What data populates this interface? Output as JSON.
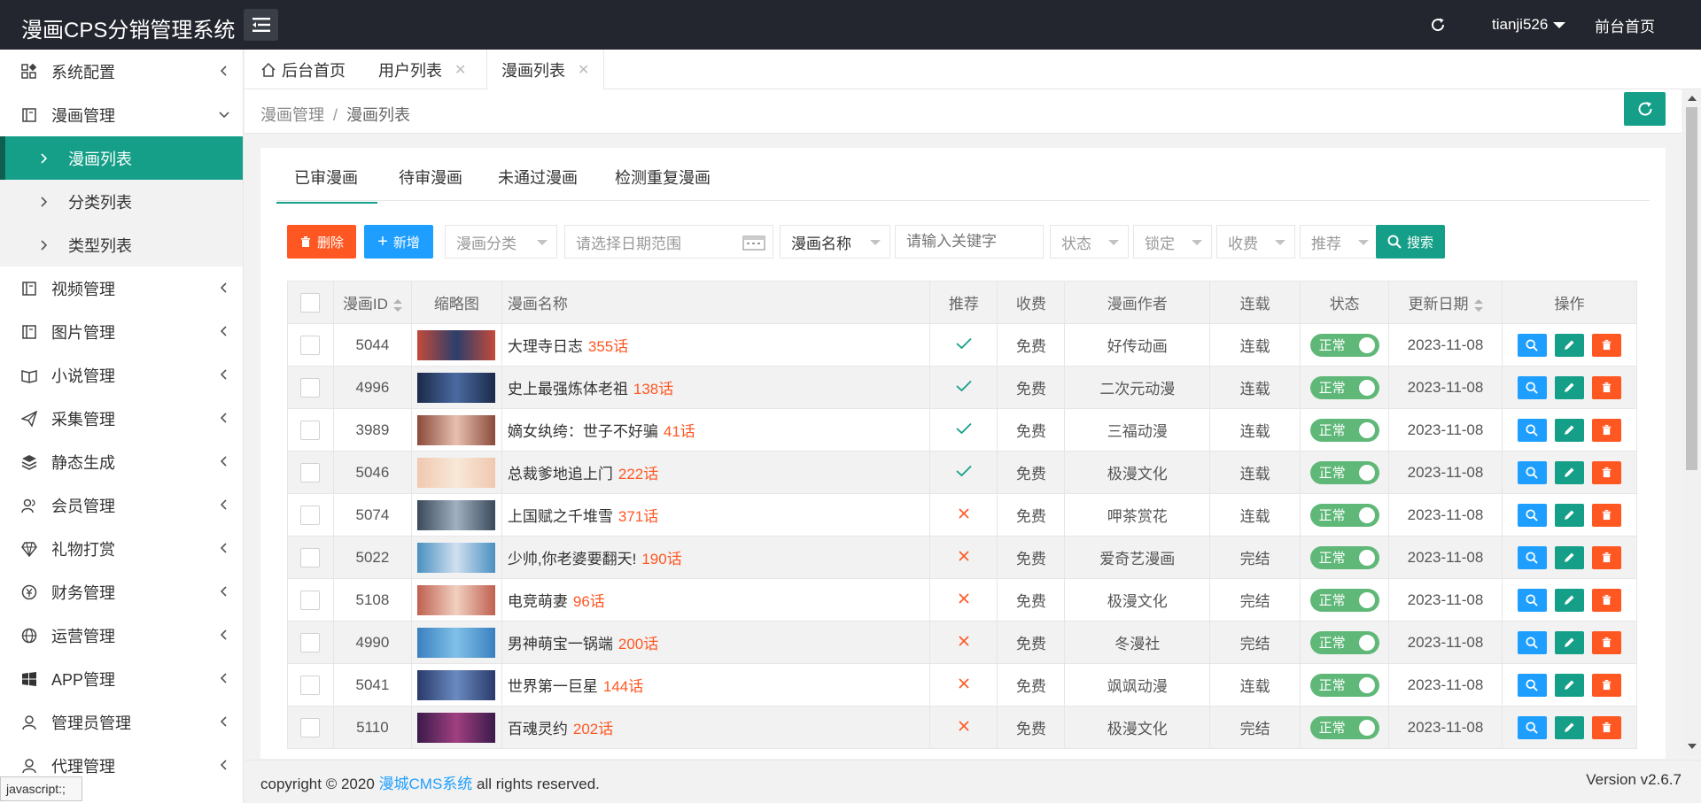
{
  "header": {
    "logo": "漫画CPS分销管理系统",
    "username": "tianji526",
    "front_link": "前台首页"
  },
  "sidebar": {
    "items": [
      {
        "label": "系统配置",
        "icon": "config-grid-icon"
      },
      {
        "label": "漫画管理",
        "icon": "comic-book-icon",
        "expanded": true
      },
      {
        "label": "视频管理",
        "icon": "video-icon"
      },
      {
        "label": "图片管理",
        "icon": "image-icon"
      },
      {
        "label": "小说管理",
        "icon": "novel-book-icon"
      },
      {
        "label": "采集管理",
        "icon": "collect-plane-icon"
      },
      {
        "label": "静态生成",
        "icon": "layers-icon"
      },
      {
        "label": "会员管理",
        "icon": "members-icon"
      },
      {
        "label": "礼物打赏",
        "icon": "diamond-icon"
      },
      {
        "label": "财务管理",
        "icon": "finance-yen-icon"
      },
      {
        "label": "运营管理",
        "icon": "globe-icon"
      },
      {
        "label": "APP管理",
        "icon": "windows-icon"
      },
      {
        "label": "管理员管理",
        "icon": "admin-user-icon"
      },
      {
        "label": "代理管理",
        "icon": "agent-icon"
      }
    ],
    "subitems": [
      {
        "label": "漫画列表",
        "active": true
      },
      {
        "label": "分类列表"
      },
      {
        "label": "类型列表"
      }
    ]
  },
  "tabs": [
    {
      "label": "后台首页"
    },
    {
      "label": "用户列表"
    },
    {
      "label": "漫画列表",
      "active": true
    }
  ],
  "breadcrumb": {
    "parent": "漫画管理",
    "sep": "/",
    "current": "漫画列表"
  },
  "subtabs": [
    "已审漫画",
    "待审漫画",
    "未通过漫画",
    "检测重复漫画"
  ],
  "toolbar": {
    "delete_label": "删除",
    "add_label": "新增",
    "category_placeholder": "漫画分类",
    "date_placeholder": "请选择日期范围",
    "field_select": "漫画名称",
    "keyword_placeholder": "请输入关键字",
    "status_placeholder": "状态",
    "lock_placeholder": "锁定",
    "fee_placeholder": "收费",
    "recommend_placeholder": "推荐",
    "search_label": "搜索"
  },
  "table": {
    "columns": [
      "漫画ID",
      "缩略图",
      "漫画名称",
      "推荐",
      "收费",
      "漫画作者",
      "连载",
      "状态",
      "更新日期",
      "操作"
    ],
    "rows": [
      {
        "id": "5044",
        "name": "大理寺日志",
        "chapters": "355话",
        "recommend": true,
        "fee": "免费",
        "author": "好传动画",
        "serial": "连载",
        "status": "正常",
        "date": "2023-11-08",
        "thumb": [
          "#c44a3a",
          "#2c3e6b"
        ]
      },
      {
        "id": "4996",
        "name": "史上最强炼体老祖",
        "chapters": "138话",
        "recommend": true,
        "fee": "免费",
        "author": "二次元动漫",
        "serial": "连载",
        "status": "正常",
        "date": "2023-11-08",
        "thumb": [
          "#1b2a4a",
          "#4a6aa0"
        ]
      },
      {
        "id": "3989",
        "name": "嫡女纨绔：世子不好骗",
        "chapters": "41话",
        "recommend": true,
        "fee": "免费",
        "author": "三福动漫",
        "serial": "连载",
        "status": "正常",
        "date": "2023-11-08",
        "thumb": [
          "#8a4a3a",
          "#e8c0b0"
        ]
      },
      {
        "id": "5046",
        "name": "总裁爹地追上门",
        "chapters": "222话",
        "recommend": true,
        "fee": "免费",
        "author": "极漫文化",
        "serial": "连载",
        "status": "正常",
        "date": "2023-11-08",
        "thumb": [
          "#f0c8b0",
          "#f8e8d8"
        ]
      },
      {
        "id": "5074",
        "name": "上国赋之千堆雪",
        "chapters": "371话",
        "recommend": false,
        "fee": "免费",
        "author": "呷茶赏花",
        "serial": "连载",
        "status": "正常",
        "date": "2023-11-08",
        "thumb": [
          "#3a4a5a",
          "#a0b0c0"
        ]
      },
      {
        "id": "5022",
        "name": "少帅,你老婆要翻天!",
        "chapters": "190话",
        "recommend": false,
        "fee": "免费",
        "author": "爱奇艺漫画",
        "serial": "完结",
        "status": "正常",
        "date": "2023-11-08",
        "thumb": [
          "#4a90c0",
          "#d0e0f0"
        ]
      },
      {
        "id": "5108",
        "name": "电竞萌妻",
        "chapters": "96话",
        "recommend": false,
        "fee": "免费",
        "author": "极漫文化",
        "serial": "完结",
        "status": "正常",
        "date": "2023-11-08",
        "thumb": [
          "#c06050",
          "#f0d0c0"
        ]
      },
      {
        "id": "4990",
        "name": "男神萌宝一锅端",
        "chapters": "200话",
        "recommend": false,
        "fee": "免费",
        "author": "冬漫社",
        "serial": "完结",
        "status": "正常",
        "date": "2023-11-08",
        "thumb": [
          "#3a80c0",
          "#80c0e8"
        ]
      },
      {
        "id": "5041",
        "name": "世界第一巨星",
        "chapters": "144话",
        "recommend": false,
        "fee": "免费",
        "author": "飒飒动漫",
        "serial": "连载",
        "status": "正常",
        "date": "2023-11-08",
        "thumb": [
          "#2a3a6a",
          "#6a8ac0"
        ]
      },
      {
        "id": "5110",
        "name": "百魂灵约",
        "chapters": "202话",
        "recommend": false,
        "fee": "免费",
        "author": "极漫文化",
        "serial": "完结",
        "status": "正常",
        "date": "2023-11-08",
        "thumb": [
          "#3a1a4a",
          "#a04080"
        ]
      }
    ]
  },
  "footer": {
    "copy_prefix": "copyright © 2020 ",
    "brand": "漫城CMS系统",
    "copy_suffix": " all rights reserved.",
    "version": "Version v2.6.7"
  },
  "statusbar": "javascript:;"
}
